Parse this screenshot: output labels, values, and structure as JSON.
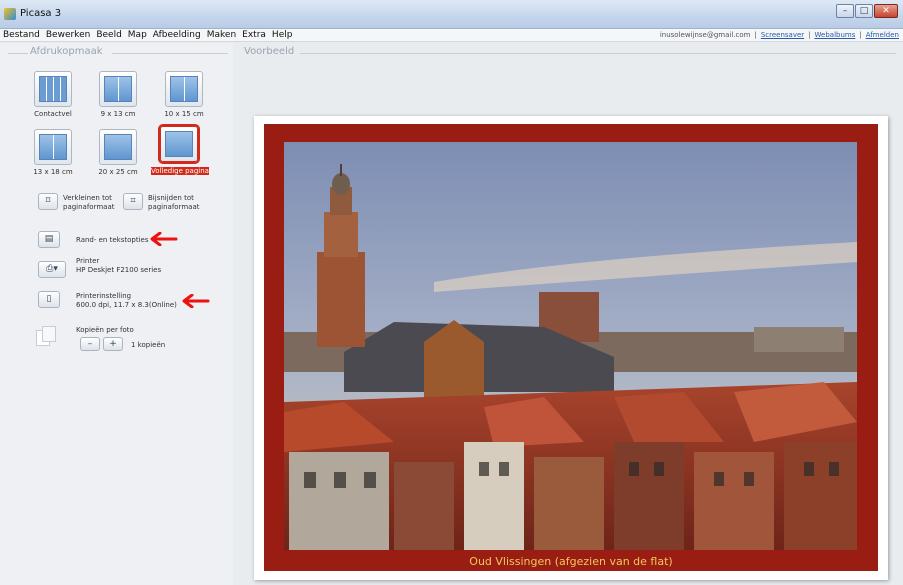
{
  "window": {
    "title": "Picasa 3",
    "controls": [
      "–",
      "□",
      "✕"
    ]
  },
  "menu": [
    "Bestand",
    "Bewerken",
    "Beeld",
    "Map",
    "Afbeelding",
    "Maken",
    "Extra",
    "Help"
  ],
  "user": {
    "email": "inusolewijnse@gmail.com",
    "links": [
      "Screensaver",
      "Webalbums",
      "Afmelden"
    ]
  },
  "left_panel": {
    "group_title": "Afdrukopmaak",
    "layouts": [
      {
        "label": "Contactvel",
        "icon": "contact-sheet-icon",
        "selected": false
      },
      {
        "label": "9 x 13 cm",
        "icon": "photo-9x13-icon",
        "selected": false
      },
      {
        "label": "10 x 15 cm",
        "icon": "photo-10x15-icon",
        "selected": false
      },
      {
        "label": "13 x 18 cm",
        "icon": "photo-13x18-icon",
        "selected": false
      },
      {
        "label": "20 x 25 cm",
        "icon": "photo-20x25-icon",
        "selected": false
      },
      {
        "label": "Volledige pagina",
        "icon": "full-page-icon",
        "selected": true
      }
    ],
    "fit_options": [
      {
        "label": "Verkleinen tot paginaformaat",
        "icon": "shrink-icon"
      },
      {
        "label": "Bijsnijden tot paginaformaat",
        "icon": "crop-icon"
      }
    ],
    "borders_label": "Rand- en tekstopties",
    "printer_heading": "Printer",
    "printer_name": "HP Deskjet F2100 series",
    "printer_setup_heading": "Printerinstelling",
    "printer_setup_value": "600.0 dpi, 11.7 x 8.3(Online)",
    "copies_heading": "Kopieën per foto",
    "copies_minus": "–",
    "copies_plus": "+",
    "copies_value": "1 kopieën"
  },
  "preview": {
    "group_title": "Voorbeeld",
    "caption": "Oud Vlissingen (afgezien van de flat)"
  },
  "colors": {
    "frame": "#9a1d13",
    "caption": "#f2c75c",
    "highlight": "#d22a1a"
  }
}
